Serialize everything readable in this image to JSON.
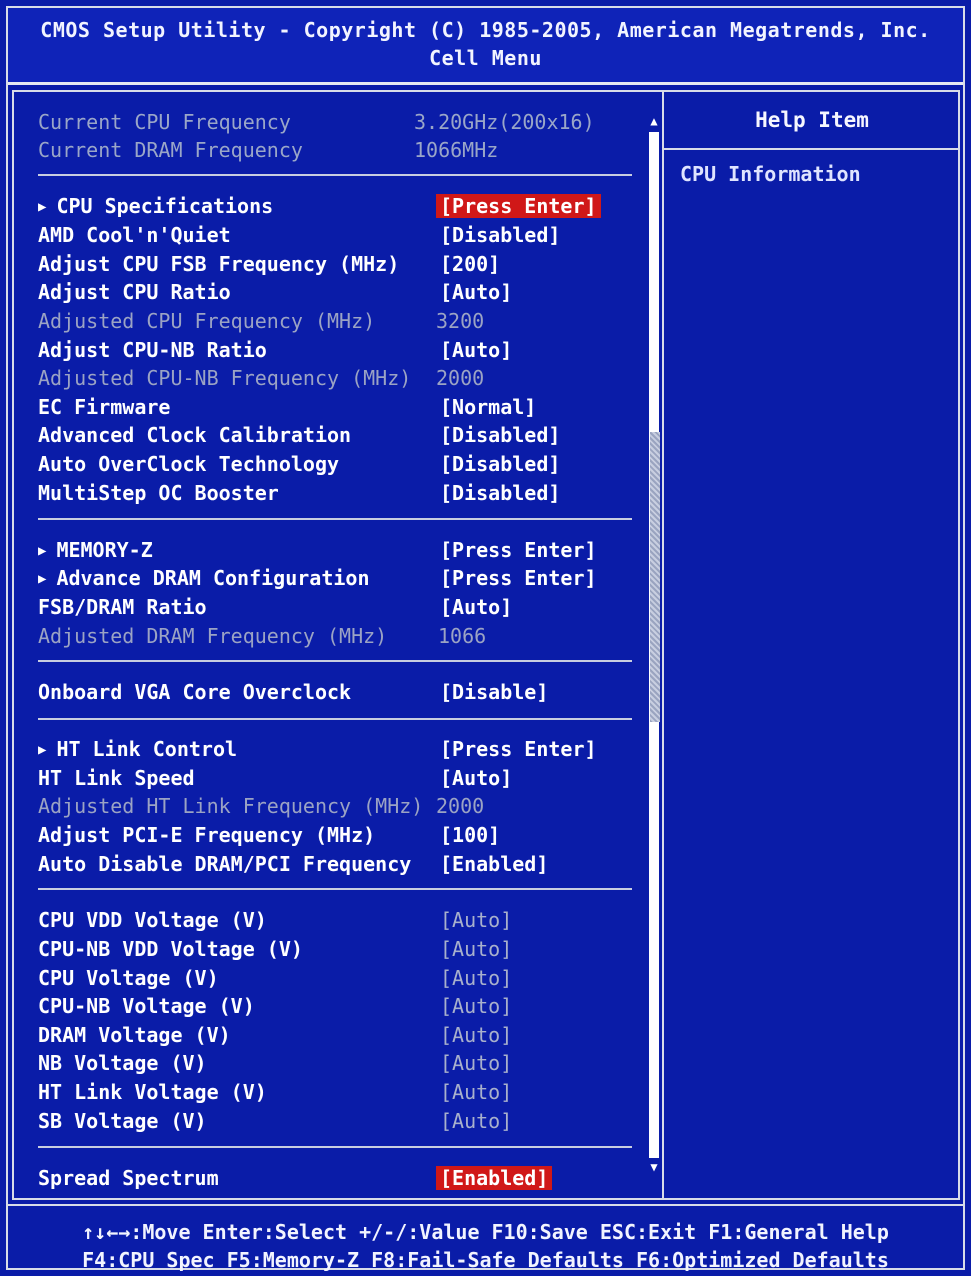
{
  "header": {
    "title": "CMOS Setup Utility - Copyright (C) 1985-2005, American Megatrends, Inc.",
    "subtitle": "Cell Menu"
  },
  "info": [
    {
      "label": "Current CPU Frequency",
      "value": "3.20GHz(200x16)"
    },
    {
      "label": "Current DRAM Frequency",
      "value": "1066MHz"
    }
  ],
  "groups": [
    [
      {
        "label": "CPU Specifications",
        "value": "[Press Enter]"
      },
      {
        "label": "AMD Cool'n'Quiet",
        "value": "[Disabled]"
      },
      {
        "label": "Adjust CPU FSB Frequency (MHz)",
        "value": "[200]"
      },
      {
        "label": "Adjust CPU Ratio",
        "value": "[Auto]"
      },
      {
        "label": "Adjusted CPU Frequency (MHz)",
        "value": "3200"
      },
      {
        "label": "Adjust CPU-NB Ratio",
        "value": "[Auto]"
      },
      {
        "label": "Adjusted CPU-NB Frequency (MHz)",
        "value": "2000"
      },
      {
        "label": "EC Firmware",
        "value": "[Normal]"
      },
      {
        "label": "Advanced Clock Calibration",
        "value": "[Disabled]"
      },
      {
        "label": "Auto OverClock Technology",
        "value": "[Disabled]"
      },
      {
        "label": "MultiStep OC Booster",
        "value": "[Disabled]"
      }
    ],
    [
      {
        "label": "MEMORY-Z",
        "value": "[Press Enter]"
      },
      {
        "label": "Advance DRAM Configuration",
        "value": "[Press Enter]"
      },
      {
        "label": "FSB/DRAM Ratio",
        "value": "[Auto]"
      },
      {
        "label": "Adjusted DRAM Frequency (MHz)",
        "value": "1066"
      }
    ],
    [
      {
        "label": "Onboard VGA Core Overclock",
        "value": "[Disable]"
      }
    ],
    [
      {
        "label": "HT Link Control",
        "value": "[Press Enter]"
      },
      {
        "label": "HT Link Speed",
        "value": "[Auto]"
      },
      {
        "label": "Adjusted HT Link Frequency (MHz)",
        "value": "2000"
      },
      {
        "label": "Adjust PCI-E Frequency (MHz)",
        "value": "[100]"
      },
      {
        "label": "Auto Disable DRAM/PCI Frequency",
        "value": "[Enabled]"
      }
    ],
    [
      {
        "label": "CPU VDD Voltage (V)",
        "value": "[Auto]"
      },
      {
        "label": "CPU-NB VDD Voltage (V)",
        "value": "[Auto]"
      },
      {
        "label": "CPU Voltage (V)",
        "value": "[Auto]"
      },
      {
        "label": "CPU-NB Voltage (V)",
        "value": "[Auto]"
      },
      {
        "label": "DRAM Voltage (V)",
        "value": "[Auto]"
      },
      {
        "label": "NB Voltage (V)",
        "value": "[Auto]"
      },
      {
        "label": "HT Link Voltage (V)",
        "value": "[Auto]"
      },
      {
        "label": "SB Voltage (V)",
        "value": "[Auto]"
      }
    ],
    [
      {
        "label": "Spread Spectrum",
        "value": "[Enabled]"
      }
    ]
  ],
  "help": {
    "title": "Help Item",
    "text": "CPU Information"
  },
  "footer": {
    "line1": "↑↓←→:Move  Enter:Select  +/-/:Value  F10:Save  ESC:Exit  F1:General Help",
    "line2": "F4:CPU Spec  F5:Memory-Z  F8:Fail-Safe Defaults  F6:Optimized Defaults"
  },
  "colors": {
    "background": "#0a1ca8",
    "highlight": "#d01818",
    "text": "#ffffff",
    "disabled_text": "#9ba3c4"
  },
  "icons": {
    "submenu": "triangle-right-icon",
    "scroll_up": "triangle-up-icon",
    "scroll_down": "triangle-down-icon"
  }
}
